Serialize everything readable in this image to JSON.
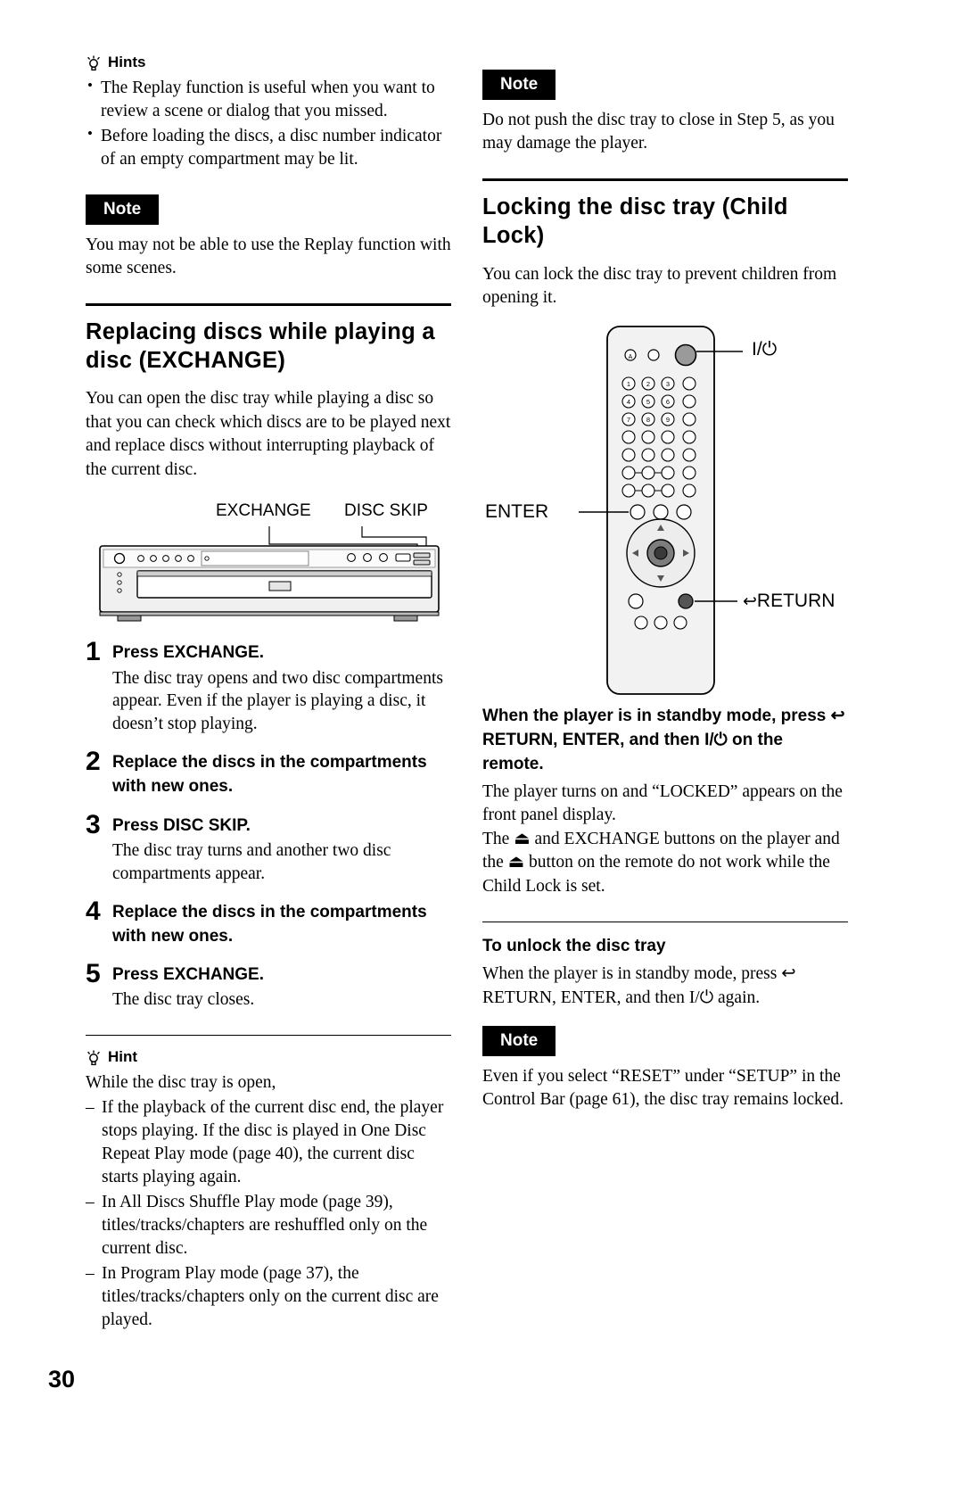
{
  "page": {
    "number": "30"
  },
  "left": {
    "hints_heading": "Hints",
    "hints": [
      "The Replay function is useful when you want to review a scene or dialog that you missed.",
      "Before loading the discs, a disc number indicator of an empty compartment may be lit."
    ],
    "note_label": "Note",
    "note_text": "You may not be able to use the Replay function with some scenes.",
    "section_title": "Replacing discs while playing a disc (EXCHANGE)",
    "section_intro": "You can open the disc tray while playing a disc so that you can check which discs are to be played next and replace discs without interrupting playback of the current disc.",
    "figure": {
      "label_exchange": "EXCHANGE",
      "label_disc_skip": "DISC SKIP"
    },
    "steps": [
      {
        "num": "1",
        "title": "Press EXCHANGE.",
        "desc": "The disc tray opens and two disc compartments appear. Even if the player is playing a disc, it doesn’t stop playing."
      },
      {
        "num": "2",
        "title": "Replace the discs in the compartments with new ones.",
        "desc": ""
      },
      {
        "num": "3",
        "title": "Press DISC SKIP.",
        "desc": "The disc tray turns and another two disc compartments appear."
      },
      {
        "num": "4",
        "title": "Replace the discs in the compartments with new ones.",
        "desc": ""
      },
      {
        "num": "5",
        "title": "Press EXCHANGE.",
        "desc": "The disc tray closes."
      }
    ],
    "hint_heading": "Hint",
    "hint_intro": "While the disc tray is open,",
    "hint_items": [
      "If the playback of the current disc end, the player stops playing. If the disc is played in One Disc Repeat Play mode (page 40), the current disc starts playing again.",
      "In All Discs Shuffle Play mode (page 39), titles/tracks/chapters are reshuffled only on the current disc.",
      "In Program Play mode (page 37), the titles/tracks/chapters only on the current disc are played."
    ]
  },
  "right": {
    "note_label_top": "Note",
    "note_text_top": "Do not push the disc tray to close in Step 5, as you may damage the player.",
    "section_title": "Locking the disc tray (Child Lock)",
    "section_intro": "You can lock the disc tray to prevent children from opening it.",
    "figure": {
      "label_power": "I/⏻",
      "label_enter": "ENTER",
      "label_return": "RETURN"
    },
    "standby_heading_part1": "When the player is in standby mode, press",
    "standby_heading_return": "RETURN, ENTER, and then",
    "standby_heading_power": "I/⏻",
    "standby_heading_tail": "on the remote.",
    "standby_body_1": "The player turns on and “LOCKED” appears on the front panel display.",
    "standby_body_2_a": "The",
    "standby_body_2_b": "and EXCHANGE buttons on the player and the",
    "standby_body_2_c": "button on the remote do not work while the Child Lock is set.",
    "unlock_heading": "To unlock the disc tray",
    "unlock_body_a": "When the player is in standby mode, press",
    "unlock_body_return": "RETURN, ENTER, and then",
    "unlock_body_power": "I/⏻",
    "unlock_body_tail": "again.",
    "note_label_bottom": "Note",
    "note_text_bottom": "Even if you select “RESET” under “SETUP” in the Control Bar (page 61), the disc tray remains locked."
  }
}
